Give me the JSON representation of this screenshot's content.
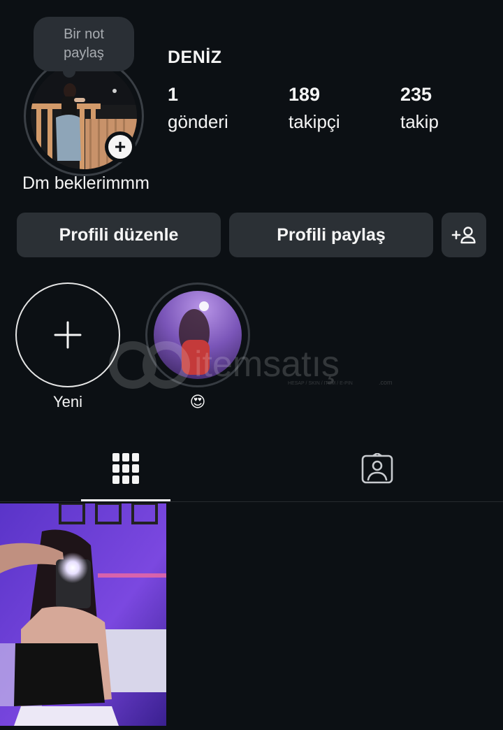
{
  "note": {
    "text_line1": "Bir not",
    "text_line2": "paylaş"
  },
  "profile": {
    "username": "DENİZ",
    "bio": "Dm beklerimmm",
    "stats": [
      {
        "value": "1",
        "label": "gönderi"
      },
      {
        "value": "189",
        "label": "takipçi"
      },
      {
        "value": "235",
        "label": "takip"
      }
    ]
  },
  "actions": {
    "edit_profile": "Profili düzenle",
    "share_profile": "Profili paylaş",
    "discover_people_icon": "add-person-icon"
  },
  "highlights": [
    {
      "label": "Yeni",
      "icon": "plus-icon"
    },
    {
      "label": "😍",
      "icon": "highlight-cover"
    }
  ],
  "watermark": {
    "brand": "itemsatış",
    "tagline": "HESAP / SKIN / ITEM / E-PIN",
    "domain": ".com"
  },
  "tabs": [
    {
      "name": "posts-grid",
      "icon": "grid-icon",
      "active": true
    },
    {
      "name": "tagged",
      "icon": "tagged-person-icon",
      "active": false
    }
  ],
  "colors": {
    "background": "#0c1014",
    "button": "#2b3035",
    "text": "#f5f5f5",
    "muted": "#a8acb1"
  }
}
